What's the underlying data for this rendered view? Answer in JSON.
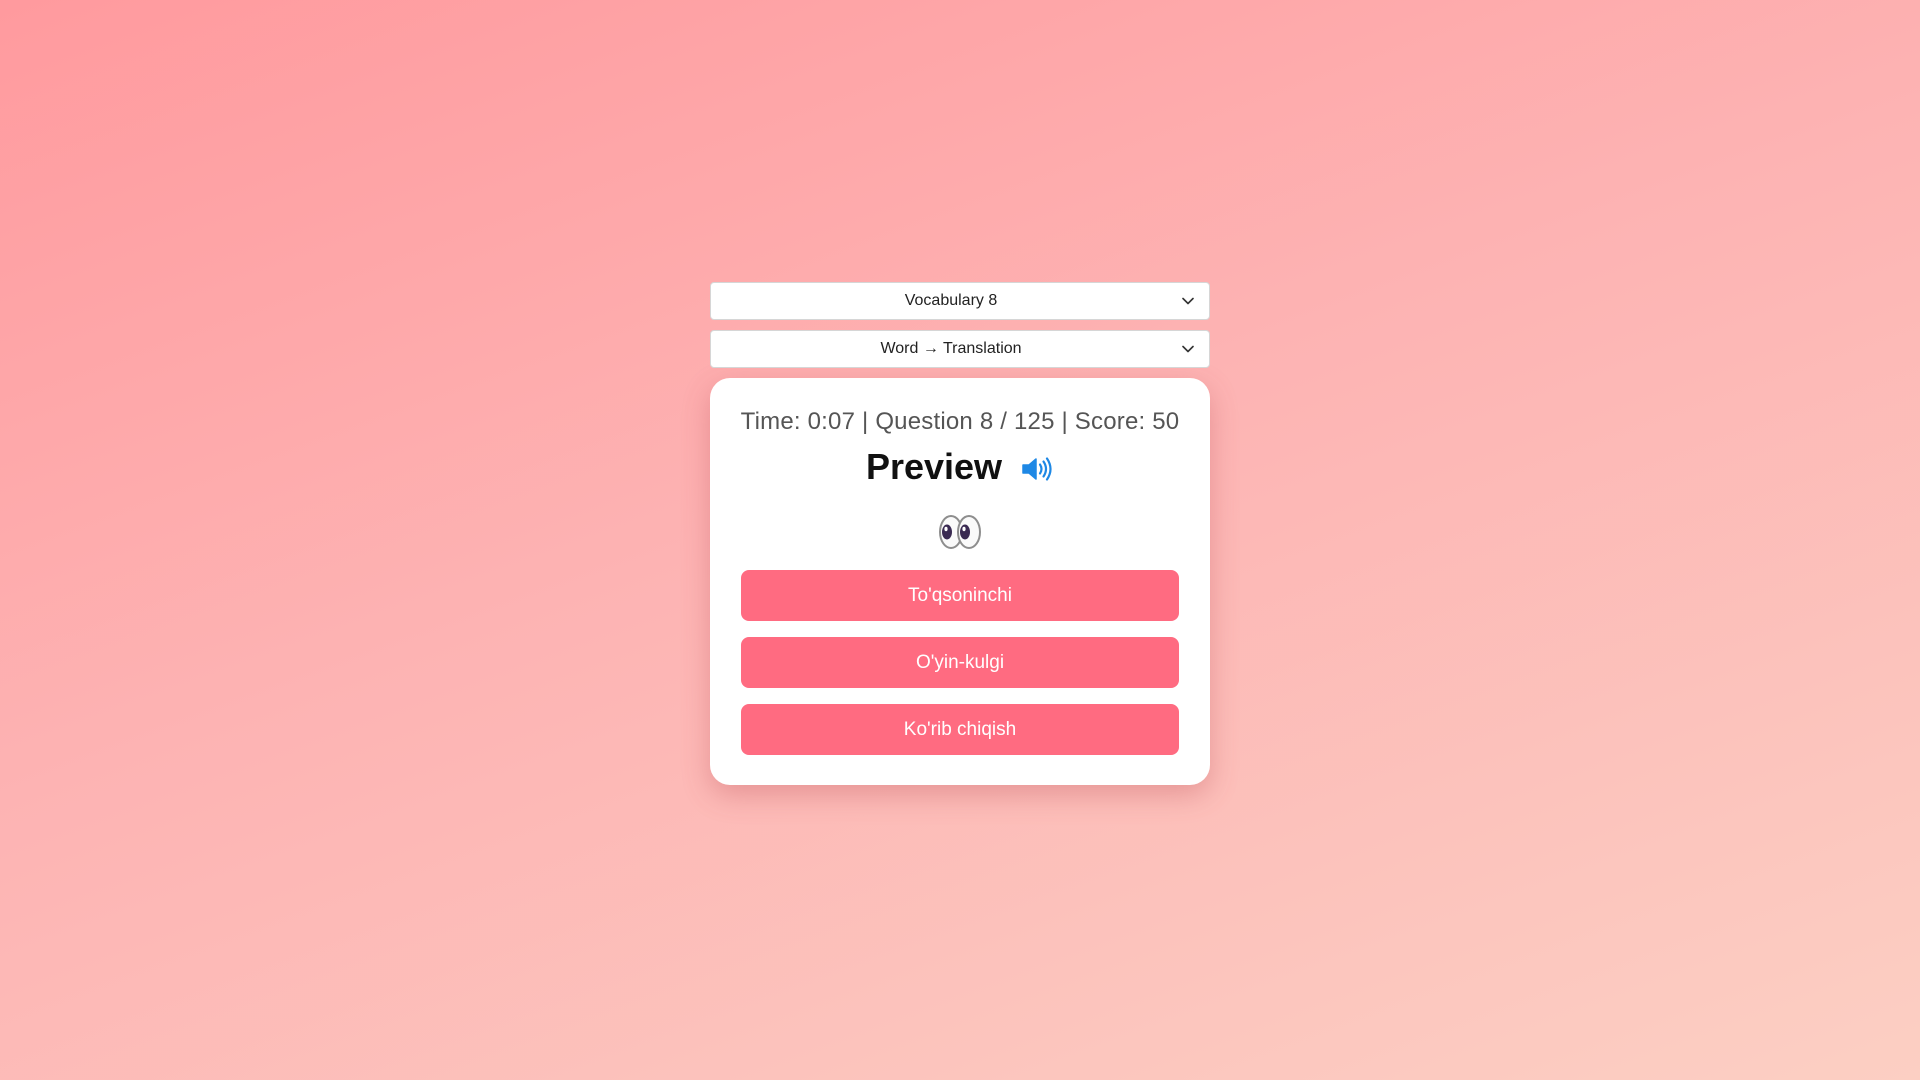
{
  "controls": {
    "vocabulary_select": "Vocabulary 8",
    "mode_select": "Word → Translation"
  },
  "quiz": {
    "status_text": "Time: 0:07 | Question 8 / 125 | Score: 50",
    "time": "0:07",
    "question_current": 8,
    "question_total": 125,
    "score": 50,
    "word": "Preview",
    "emoji": "👀",
    "answers": [
      "To'qsoninchi",
      "O'yin-kulgi",
      "Ko'rib chiqish"
    ]
  },
  "icons": {
    "select_arrow": "chevron-down-icon",
    "audio": "speaker-icon",
    "hint": "eyes-icon"
  },
  "colors": {
    "background_start": "#ff9a9e",
    "background_end": "#fccfc3",
    "answer_button": "#ff6b81",
    "speaker_icon": "#1e88e5",
    "card": "#ffffff"
  }
}
